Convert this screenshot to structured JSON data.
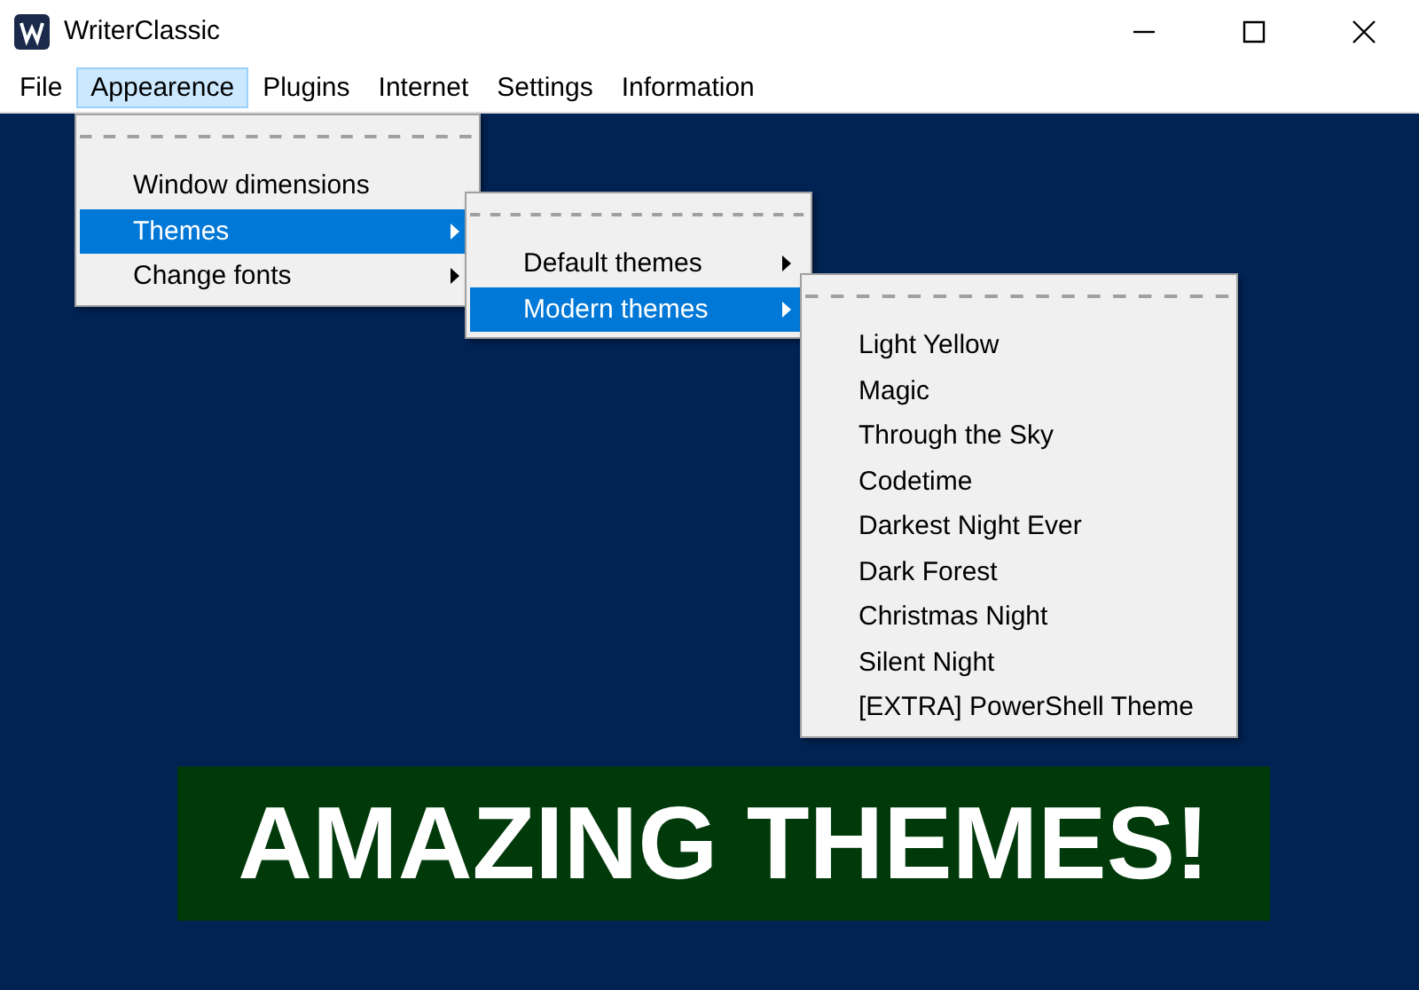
{
  "window": {
    "title": "WriterClassic"
  },
  "menubar": [
    {
      "label": "File",
      "selected": false
    },
    {
      "label": "Appearence",
      "selected": true
    },
    {
      "label": "Plugins",
      "selected": false
    },
    {
      "label": "Internet",
      "selected": false
    },
    {
      "label": "Settings",
      "selected": false
    },
    {
      "label": "Information",
      "selected": false
    }
  ],
  "menus": [
    {
      "items": [
        {
          "kind": "tearoff"
        },
        {
          "kind": "item",
          "label": "Window dimensions",
          "selected": false,
          "submenu": false
        },
        {
          "kind": "item",
          "label": "Themes",
          "selected": true,
          "submenu": true
        },
        {
          "kind": "item",
          "label": "Change fonts",
          "selected": false,
          "submenu": true
        }
      ]
    },
    {
      "items": [
        {
          "kind": "tearoff"
        },
        {
          "kind": "item",
          "label": "Default themes",
          "selected": false,
          "submenu": true
        },
        {
          "kind": "item",
          "label": "Modern themes",
          "selected": true,
          "submenu": true
        }
      ]
    },
    {
      "items": [
        {
          "kind": "tearoff"
        },
        {
          "kind": "item",
          "label": "Light Yellow",
          "selected": false,
          "submenu": false
        },
        {
          "kind": "item",
          "label": "Magic",
          "selected": false,
          "submenu": false
        },
        {
          "kind": "item",
          "label": "Through the Sky",
          "selected": false,
          "submenu": false
        },
        {
          "kind": "item",
          "label": "Codetime",
          "selected": false,
          "submenu": false
        },
        {
          "kind": "item",
          "label": "Darkest Night Ever",
          "selected": false,
          "submenu": false
        },
        {
          "kind": "item",
          "label": "Dark Forest",
          "selected": false,
          "submenu": false
        },
        {
          "kind": "item",
          "label": "Christmas Night",
          "selected": false,
          "submenu": false
        },
        {
          "kind": "item",
          "label": "Silent Night",
          "selected": false,
          "submenu": false
        },
        {
          "kind": "item",
          "label": "[EXTRA] PowerShell Theme",
          "selected": false,
          "submenu": false
        }
      ]
    }
  ],
  "banner": {
    "text": "AMAZING THEMES!"
  }
}
